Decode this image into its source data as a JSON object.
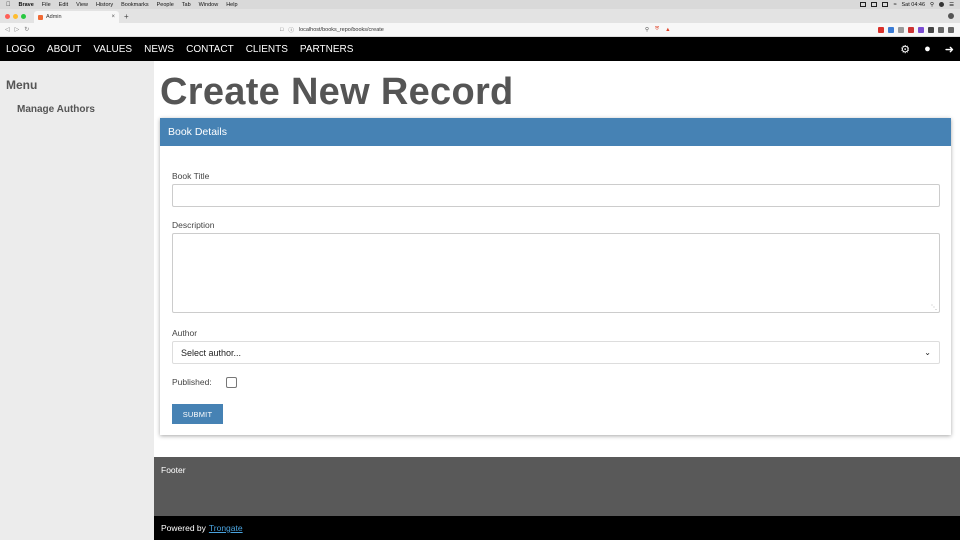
{
  "macos": {
    "apple_icon": "apple-icon",
    "menu": [
      "Brave",
      "File",
      "Edit",
      "View",
      "History",
      "Bookmarks",
      "People",
      "Tab",
      "Window",
      "Help"
    ],
    "clock": "Sat 04:46"
  },
  "browser": {
    "tab_title": "Admin",
    "tab_close": "×",
    "new_tab": "+",
    "url": "localhost/books_repo/books/create"
  },
  "nav": {
    "items": [
      "LOGO",
      "ABOUT",
      "VALUES",
      "NEWS",
      "CONTACT",
      "CLIENTS",
      "PARTNERS"
    ],
    "icons": [
      "settings-icon",
      "user-icon",
      "logout-icon"
    ]
  },
  "sidebar": {
    "title": "Menu",
    "items": [
      {
        "label": "Manage Authors"
      }
    ]
  },
  "main": {
    "title": "Create New Record",
    "card_title": "Book Details",
    "form": {
      "book_title_label": "Book Title",
      "book_title_value": "",
      "description_label": "Description",
      "description_value": "",
      "author_label": "Author",
      "author_selected": "Select author...",
      "published_label": "Published:",
      "published_checked": false,
      "submit_label": "SUBMIT"
    }
  },
  "footer": {
    "text": "Footer",
    "powered_prefix": "Powered by",
    "powered_link": "Trongate"
  },
  "colors": {
    "accent": "#4682b4",
    "nav_bg": "#000000",
    "sidebar_bg": "#ececec",
    "footer_bg": "#595959",
    "link": "#4aa3df"
  }
}
